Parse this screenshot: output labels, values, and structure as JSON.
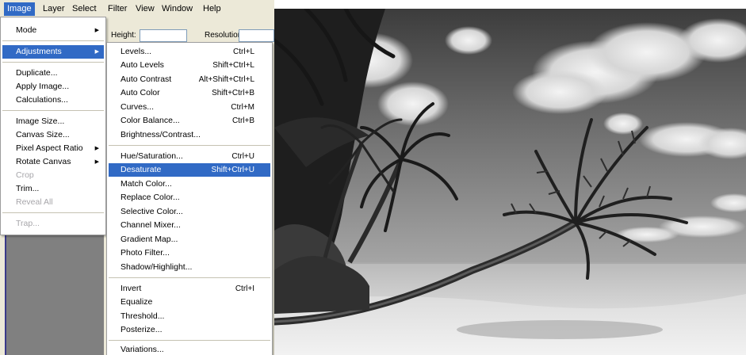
{
  "menubar": {
    "items": [
      "Image",
      "Layer",
      "Select",
      "Filter",
      "View",
      "Window",
      "Help"
    ]
  },
  "options_bar": {
    "height_label": "Height:",
    "resolution_label": "Resolution:"
  },
  "image_menu": {
    "items": [
      {
        "label": "Mode",
        "submenu": true
      },
      {
        "label": "Adjustments",
        "submenu": true,
        "state": "highlighted"
      },
      {
        "label": "Duplicate..."
      },
      {
        "label": "Apply Image..."
      },
      {
        "label": "Calculations..."
      },
      {
        "label": "Image Size..."
      },
      {
        "label": "Canvas Size..."
      },
      {
        "label": "Pixel Aspect Ratio",
        "submenu": true
      },
      {
        "label": "Rotate Canvas",
        "submenu": true
      },
      {
        "label": "Crop",
        "state": "disabled"
      },
      {
        "label": "Trim..."
      },
      {
        "label": "Reveal All",
        "state": "disabled"
      },
      {
        "label": "Trap...",
        "state": "disabled"
      }
    ]
  },
  "adjustments_menu": {
    "items": [
      {
        "label": "Levels...",
        "shortcut": "Ctrl+L"
      },
      {
        "label": "Auto Levels",
        "shortcut": "Shift+Ctrl+L"
      },
      {
        "label": "Auto Contrast",
        "shortcut": "Alt+Shift+Ctrl+L"
      },
      {
        "label": "Auto Color",
        "shortcut": "Shift+Ctrl+B"
      },
      {
        "label": "Curves...",
        "shortcut": "Ctrl+M"
      },
      {
        "label": "Color Balance...",
        "shortcut": "Ctrl+B"
      },
      {
        "label": "Brightness/Contrast..."
      },
      {
        "label": "Hue/Saturation...",
        "shortcut": "Ctrl+U"
      },
      {
        "label": "Desaturate",
        "shortcut": "Shift+Ctrl+U",
        "state": "highlighted"
      },
      {
        "label": "Match Color..."
      },
      {
        "label": "Replace Color..."
      },
      {
        "label": "Selective Color..."
      },
      {
        "label": "Channel Mixer..."
      },
      {
        "label": "Gradient Map..."
      },
      {
        "label": "Photo Filter..."
      },
      {
        "label": "Shadow/Highlight..."
      },
      {
        "label": "Invert",
        "shortcut": "Ctrl+I"
      },
      {
        "label": "Equalize"
      },
      {
        "label": "Threshold..."
      },
      {
        "label": "Posterize..."
      },
      {
        "label": "Variations..."
      }
    ]
  },
  "colors": {
    "highlight": "#316ac5",
    "menu_bg": "#ffffff",
    "chrome_bg": "#ece9d8",
    "disabled_text": "#a7a6aa"
  }
}
